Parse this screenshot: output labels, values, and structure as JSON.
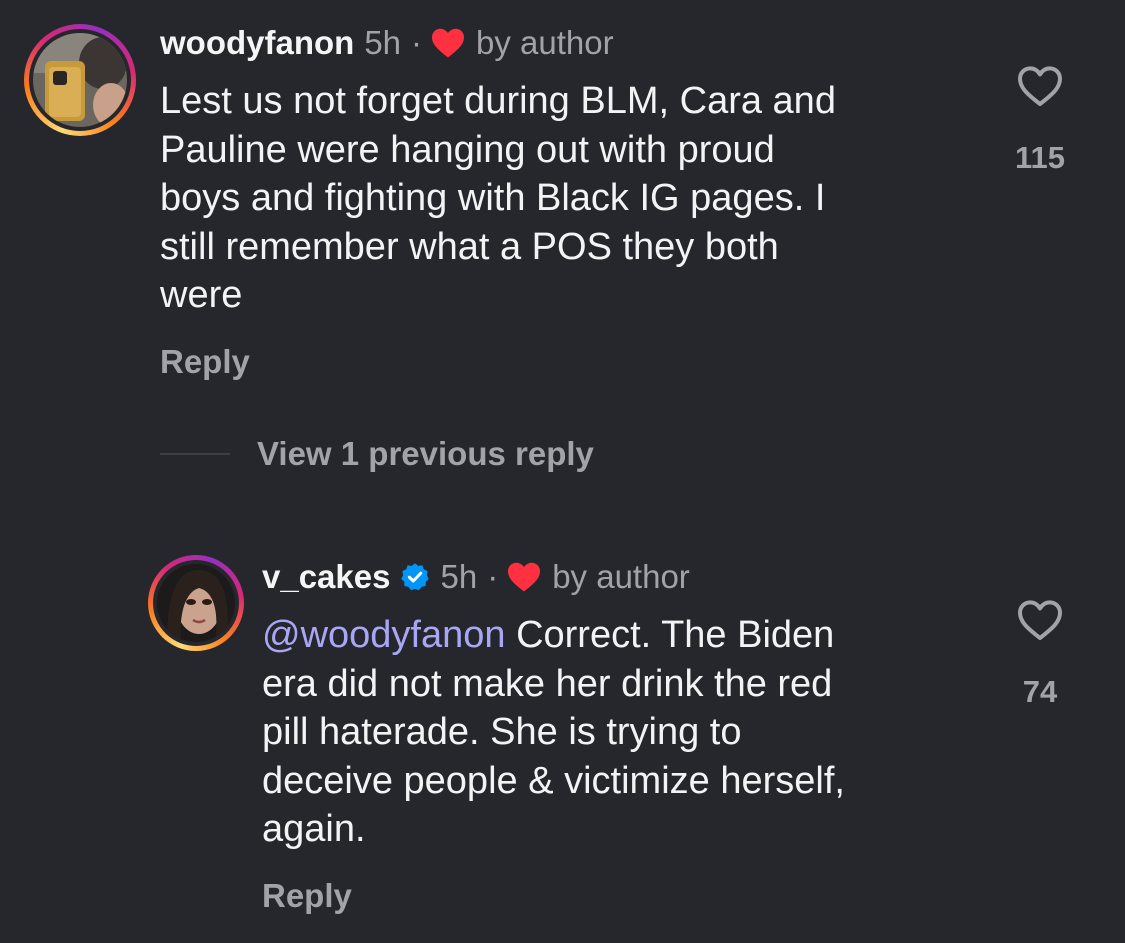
{
  "comments": [
    {
      "username": "woodyfanon",
      "time": "5h",
      "dot": "·",
      "by_author": "by author",
      "verified": false,
      "text": "Lest us not forget during BLM, Cara and\nPauline were hanging out with proud\nboys and fighting with Black IG pages. I\nstill remember what a POS they both\nwere",
      "reply_label": "Reply",
      "likes": "115"
    },
    {
      "username": "v_cakes",
      "time": "5h",
      "dot": "·",
      "by_author": "by author",
      "verified": true,
      "mention": "@woodyfanon",
      "text": " Correct.  The Biden\nera did not make her drink the red\npill haterade.  She is trying to\ndeceive people & victimize herself,\nagain.",
      "reply_label": "Reply",
      "likes": "74"
    }
  ],
  "view_previous_label": "View 1 previous reply",
  "colors": {
    "background": "#25272c",
    "text": "#f3f3f5",
    "muted": "#a1a3a9",
    "mention": "#a9a7f5",
    "author_heart": "#ff3040",
    "verified": "#0095f6"
  },
  "icons": {
    "like": "heart-outline-icon",
    "author_like": "heart-filled-icon",
    "verified": "verified-badge-icon"
  }
}
